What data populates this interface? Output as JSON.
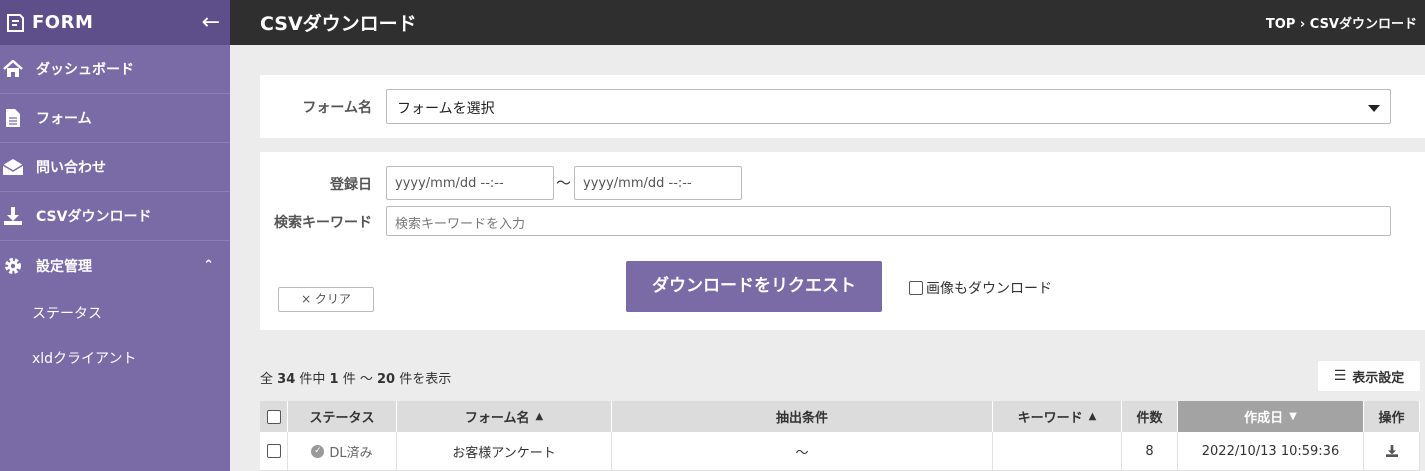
{
  "sidebar": {
    "brand": "FORM",
    "items": [
      {
        "label": "ダッシュボード",
        "icon": "home-icon"
      },
      {
        "label": "フォーム",
        "icon": "document-icon"
      },
      {
        "label": "問い合わせ",
        "icon": "envelope-icon"
      },
      {
        "label": "CSVダウンロード",
        "icon": "download-icon"
      },
      {
        "label": "設定管理",
        "icon": "gear-icon"
      }
    ],
    "sub_items": [
      {
        "label": "ステータス"
      },
      {
        "label": "xldクライアント"
      }
    ]
  },
  "header": {
    "title": "CSVダウンロード",
    "breadcrumb_top": "TOP",
    "breadcrumb_sep": "›",
    "breadcrumb_current": "CSVダウンロード"
  },
  "form_select": {
    "label": "フォーム名",
    "value": "フォームを選択"
  },
  "filters": {
    "date_label": "登録日",
    "date_from_placeholder": "yyyy/mm/dd --:--",
    "date_sep": "〜",
    "date_to_placeholder": "yyyy/mm/dd --:--",
    "keyword_label": "検索キーワード",
    "keyword_placeholder": "検索キーワードを入力",
    "clear_label": "× クリア",
    "request_label": "ダウンロードをリクエスト",
    "with_images_label": "画像もダウンロード"
  },
  "results": {
    "prefix": "全",
    "total": "34",
    "mid1": "件中",
    "from": "1",
    "mid2": "件 〜",
    "to": "20",
    "suffix": "件を表示",
    "display_settings_label": "表示設定"
  },
  "table": {
    "columns": [
      "ステータス",
      "フォーム名",
      "抽出条件",
      "キーワード",
      "件数",
      "作成日",
      "操作"
    ],
    "rows": [
      {
        "status": "DL済み",
        "form_name": "お客様アンケート",
        "condition": "〜",
        "keyword": "",
        "count": "8",
        "created": "2022/10/13 10:59:36"
      }
    ]
  },
  "colors": {
    "sidebar_bg": "#7a6aa5",
    "sidebar_head": "#5e4f8a",
    "topbar_bg": "#2f2f2f",
    "accent": "#7a6aa5"
  }
}
